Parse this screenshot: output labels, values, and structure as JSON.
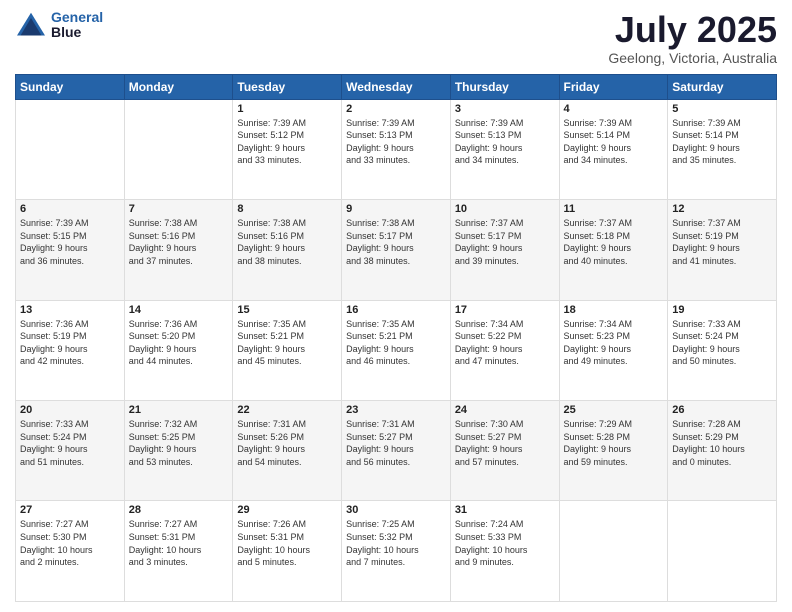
{
  "header": {
    "logo_line1": "General",
    "logo_line2": "Blue",
    "month": "July 2025",
    "location": "Geelong, Victoria, Australia"
  },
  "weekdays": [
    "Sunday",
    "Monday",
    "Tuesday",
    "Wednesday",
    "Thursday",
    "Friday",
    "Saturday"
  ],
  "weeks": [
    [
      {
        "day": "",
        "info": ""
      },
      {
        "day": "",
        "info": ""
      },
      {
        "day": "1",
        "info": "Sunrise: 7:39 AM\nSunset: 5:12 PM\nDaylight: 9 hours\nand 33 minutes."
      },
      {
        "day": "2",
        "info": "Sunrise: 7:39 AM\nSunset: 5:13 PM\nDaylight: 9 hours\nand 33 minutes."
      },
      {
        "day": "3",
        "info": "Sunrise: 7:39 AM\nSunset: 5:13 PM\nDaylight: 9 hours\nand 34 minutes."
      },
      {
        "day": "4",
        "info": "Sunrise: 7:39 AM\nSunset: 5:14 PM\nDaylight: 9 hours\nand 34 minutes."
      },
      {
        "day": "5",
        "info": "Sunrise: 7:39 AM\nSunset: 5:14 PM\nDaylight: 9 hours\nand 35 minutes."
      }
    ],
    [
      {
        "day": "6",
        "info": "Sunrise: 7:39 AM\nSunset: 5:15 PM\nDaylight: 9 hours\nand 36 minutes."
      },
      {
        "day": "7",
        "info": "Sunrise: 7:38 AM\nSunset: 5:16 PM\nDaylight: 9 hours\nand 37 minutes."
      },
      {
        "day": "8",
        "info": "Sunrise: 7:38 AM\nSunset: 5:16 PM\nDaylight: 9 hours\nand 38 minutes."
      },
      {
        "day": "9",
        "info": "Sunrise: 7:38 AM\nSunset: 5:17 PM\nDaylight: 9 hours\nand 38 minutes."
      },
      {
        "day": "10",
        "info": "Sunrise: 7:37 AM\nSunset: 5:17 PM\nDaylight: 9 hours\nand 39 minutes."
      },
      {
        "day": "11",
        "info": "Sunrise: 7:37 AM\nSunset: 5:18 PM\nDaylight: 9 hours\nand 40 minutes."
      },
      {
        "day": "12",
        "info": "Sunrise: 7:37 AM\nSunset: 5:19 PM\nDaylight: 9 hours\nand 41 minutes."
      }
    ],
    [
      {
        "day": "13",
        "info": "Sunrise: 7:36 AM\nSunset: 5:19 PM\nDaylight: 9 hours\nand 42 minutes."
      },
      {
        "day": "14",
        "info": "Sunrise: 7:36 AM\nSunset: 5:20 PM\nDaylight: 9 hours\nand 44 minutes."
      },
      {
        "day": "15",
        "info": "Sunrise: 7:35 AM\nSunset: 5:21 PM\nDaylight: 9 hours\nand 45 minutes."
      },
      {
        "day": "16",
        "info": "Sunrise: 7:35 AM\nSunset: 5:21 PM\nDaylight: 9 hours\nand 46 minutes."
      },
      {
        "day": "17",
        "info": "Sunrise: 7:34 AM\nSunset: 5:22 PM\nDaylight: 9 hours\nand 47 minutes."
      },
      {
        "day": "18",
        "info": "Sunrise: 7:34 AM\nSunset: 5:23 PM\nDaylight: 9 hours\nand 49 minutes."
      },
      {
        "day": "19",
        "info": "Sunrise: 7:33 AM\nSunset: 5:24 PM\nDaylight: 9 hours\nand 50 minutes."
      }
    ],
    [
      {
        "day": "20",
        "info": "Sunrise: 7:33 AM\nSunset: 5:24 PM\nDaylight: 9 hours\nand 51 minutes."
      },
      {
        "day": "21",
        "info": "Sunrise: 7:32 AM\nSunset: 5:25 PM\nDaylight: 9 hours\nand 53 minutes."
      },
      {
        "day": "22",
        "info": "Sunrise: 7:31 AM\nSunset: 5:26 PM\nDaylight: 9 hours\nand 54 minutes."
      },
      {
        "day": "23",
        "info": "Sunrise: 7:31 AM\nSunset: 5:27 PM\nDaylight: 9 hours\nand 56 minutes."
      },
      {
        "day": "24",
        "info": "Sunrise: 7:30 AM\nSunset: 5:27 PM\nDaylight: 9 hours\nand 57 minutes."
      },
      {
        "day": "25",
        "info": "Sunrise: 7:29 AM\nSunset: 5:28 PM\nDaylight: 9 hours\nand 59 minutes."
      },
      {
        "day": "26",
        "info": "Sunrise: 7:28 AM\nSunset: 5:29 PM\nDaylight: 10 hours\nand 0 minutes."
      }
    ],
    [
      {
        "day": "27",
        "info": "Sunrise: 7:27 AM\nSunset: 5:30 PM\nDaylight: 10 hours\nand 2 minutes."
      },
      {
        "day": "28",
        "info": "Sunrise: 7:27 AM\nSunset: 5:31 PM\nDaylight: 10 hours\nand 3 minutes."
      },
      {
        "day": "29",
        "info": "Sunrise: 7:26 AM\nSunset: 5:31 PM\nDaylight: 10 hours\nand 5 minutes."
      },
      {
        "day": "30",
        "info": "Sunrise: 7:25 AM\nSunset: 5:32 PM\nDaylight: 10 hours\nand 7 minutes."
      },
      {
        "day": "31",
        "info": "Sunrise: 7:24 AM\nSunset: 5:33 PM\nDaylight: 10 hours\nand 9 minutes."
      },
      {
        "day": "",
        "info": ""
      },
      {
        "day": "",
        "info": ""
      }
    ]
  ]
}
